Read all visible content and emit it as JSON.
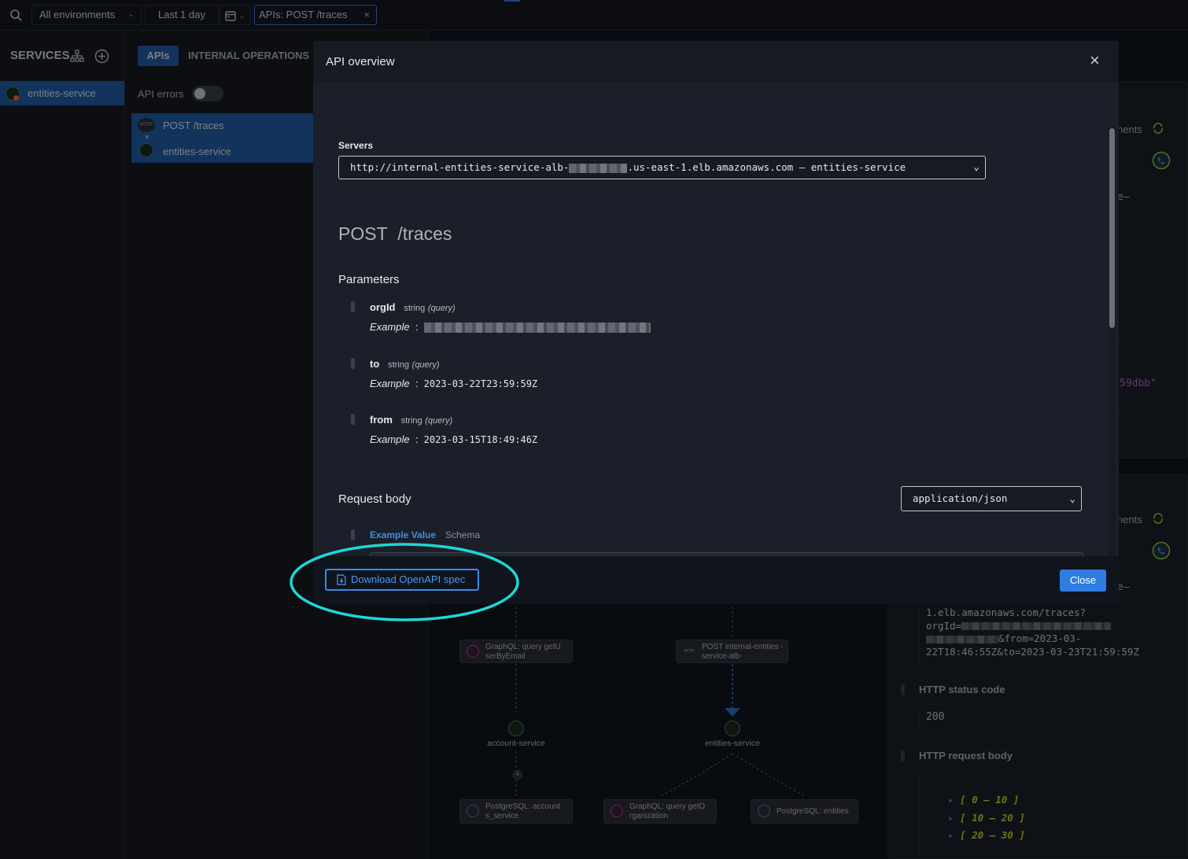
{
  "topbar": {
    "environment": "All environments",
    "time_range": "Last 1 day",
    "filter_chip": "APIs:  POST /traces",
    "filter_close": "×"
  },
  "services_panel": {
    "title": "SERVICES",
    "add": "+",
    "items": [
      {
        "label": "entities-service"
      }
    ]
  },
  "api_panel": {
    "tabs": [
      {
        "label": "APIs",
        "active": true
      },
      {
        "label": "INTERNAL OPERATIONS",
        "active": false
      }
    ],
    "api_errors_label": "API errors",
    "api_errors_enabled": false,
    "selected_api": "POST /traces",
    "selected_service": "entities-service",
    "http_badge": "HTTP"
  },
  "background": {
    "right_snippets": [
      "nents",
      "e–",
      "59dbb\"",
      "nents",
      "e–"
    ],
    "url_lines": [
      "1.elb.amazonaws.com/traces?",
      "orgId=",
      "&from=2023-03-",
      "22T18:46:55Z&to=2023-03-23T21:59:59Z"
    ],
    "http_status_label": "HTTP status code",
    "http_status_value": "200",
    "http_body_label": "HTTP request body",
    "ranges": [
      "[ 0 – 10 ]",
      "[ 10 – 20 ]",
      "[ 20 – 30 ]"
    ],
    "graph": {
      "nodes": [
        {
          "label": "GraphQL:  query getU serByEmail"
        },
        {
          "label": "POST internal-entities -service-alb-"
        },
        {
          "label": "account-service"
        },
        {
          "label": "entities-service"
        },
        {
          "label": "PostgreSQL:  account s_service"
        },
        {
          "label": "GraphQL:  query getO rganization"
        },
        {
          "label": "PostgreSQL:  entities"
        }
      ],
      "edge_count": "4"
    }
  },
  "modal": {
    "title": "API overview",
    "close_icon": "×",
    "servers_label": "Servers",
    "server_prefix": "http://internal-entities-service-alb-",
    "server_suffix": ".us-east-1.elb.amazonaws.com – entities-service",
    "method": "POST",
    "path": "/traces",
    "parameters_label": "Parameters",
    "parameters": [
      {
        "name": "orgId",
        "type": "string",
        "in": "(query)",
        "example_label": "Example",
        "example": ""
      },
      {
        "name": "to",
        "type": "string",
        "in": "(query)",
        "example_label": "Example",
        "example": "2023-03-22T23:59:59Z"
      },
      {
        "name": "from",
        "type": "string",
        "in": "(query)",
        "example_label": "Example",
        "example": "2023-03-15T18:49:46Z"
      }
    ],
    "request_body_label": "Request body",
    "content_type": "application/json",
    "example_value_tab": "Example Value",
    "schema_tab": "Schema",
    "code_open": "[",
    "code_close": "]",
    "download_button": "Download OpenAPI spec",
    "close_button": "Close"
  },
  "colors": {
    "accent": "#3f7fd6",
    "highlight_ring": "#1fd6d6",
    "primary_button": "#2f7de1"
  }
}
